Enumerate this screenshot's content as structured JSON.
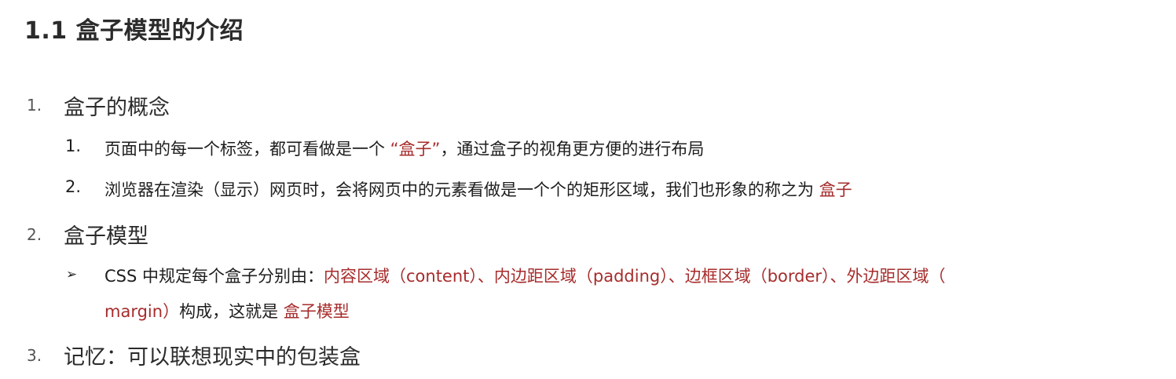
{
  "title": "1.1 盒子模型的介绍",
  "sections": [
    {
      "number": "1.",
      "heading": "盒子的概念",
      "items": [
        {
          "number": "1.",
          "text_before": "页面中的每一个标签，都可看做是一个",
          "highlight": " “盒子”",
          "text_after": "，通过盒子的视角更方便的进行布局"
        },
        {
          "number": "2.",
          "text_before": "浏览器在渲染（显示）网页时，会将网页中的元素看做是一个个的矩形区域，我们也形象的称之为",
          "highlight": " 盒子"
        }
      ]
    },
    {
      "number": "2.",
      "heading": "盒子模型",
      "bullet": "➢",
      "line1_prefix": "CSS 中规定每个盒子分别由：",
      "line1_highlight": "内容区域（content）、内边距区域（padding）、边框区域（border）、外边距区域（",
      "line2_highlight": "margin）",
      "line2_text": "构成，这就是",
      "line2_highlight_end": " 盒子模型"
    },
    {
      "number": "3.",
      "heading": "记忆：可以联想现实中的包装盒"
    }
  ],
  "colors": {
    "accent": "#a72c2c",
    "text": "#1e1e1e"
  }
}
